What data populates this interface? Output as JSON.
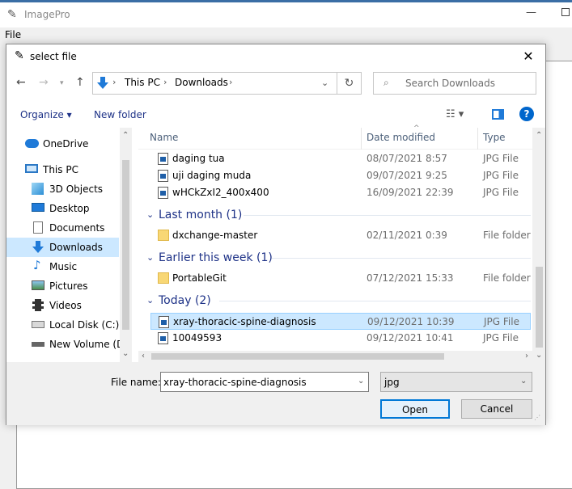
{
  "app": {
    "title": "ImagePro",
    "menu": {
      "file": "File"
    }
  },
  "dialog": {
    "title": "select file",
    "address": {
      "segments": [
        "This PC",
        "Downloads"
      ],
      "separator": "›"
    },
    "search": {
      "placeholder": "Search Downloads"
    },
    "toolbar": {
      "organize": "Organize",
      "new_folder": "New folder"
    },
    "nav": [
      {
        "label": "OneDrive",
        "icon": "cloud-icon"
      },
      {
        "label": "This PC",
        "icon": "computer-icon"
      },
      {
        "label": "3D Objects",
        "icon": "cube-icon"
      },
      {
        "label": "Desktop",
        "icon": "desktop-icon"
      },
      {
        "label": "Documents",
        "icon": "document-icon"
      },
      {
        "label": "Downloads",
        "icon": "download-icon",
        "selected": true
      },
      {
        "label": "Music",
        "icon": "music-icon"
      },
      {
        "label": "Pictures",
        "icon": "pictures-icon"
      },
      {
        "label": "Videos",
        "icon": "videos-icon"
      },
      {
        "label": "Local Disk (C:)",
        "icon": "disk-icon"
      },
      {
        "label": "New Volume (D:",
        "icon": "drive-icon"
      }
    ],
    "columns": {
      "name": "Name",
      "date": "Date modified",
      "type": "Type"
    },
    "files_top": [
      {
        "name": "daging tua",
        "date": "08/07/2021 8:57",
        "type": "JPG File"
      },
      {
        "name": "uji daging muda",
        "date": "09/07/2021 9:25",
        "type": "JPG File"
      },
      {
        "name": "wHCkZxI2_400x400",
        "date": "16/09/2021 22:39",
        "type": "JPG File"
      }
    ],
    "groups": [
      {
        "label": "Last month (1)",
        "items": [
          {
            "name": "dxchange-master",
            "date": "02/11/2021 0:39",
            "type": "File folder",
            "kind": "folder"
          }
        ]
      },
      {
        "label": "Earlier this week (1)",
        "items": [
          {
            "name": "PortableGit",
            "date": "07/12/2021 15:33",
            "type": "File folder",
            "kind": "folder"
          }
        ]
      },
      {
        "label": "Today (2)",
        "items": [
          {
            "name": "xray-thoracic-spine-diagnosis",
            "date": "09/12/2021 10:39",
            "type": "JPG File",
            "kind": "file",
            "selected": true
          },
          {
            "name": "10049593",
            "date": "09/12/2021 10:41",
            "type": "JPG File",
            "kind": "file"
          }
        ]
      }
    ],
    "bottom": {
      "file_name_label": "File name:",
      "file_name_value": "xray-thoracic-spine-diagnosis",
      "file_type_value": "jpg",
      "open": "Open",
      "cancel": "Cancel"
    }
  },
  "colors": {
    "accent": "#0078d7",
    "selection": "#cce8ff",
    "group_heading": "#1e3287",
    "help": "#0066cc"
  }
}
